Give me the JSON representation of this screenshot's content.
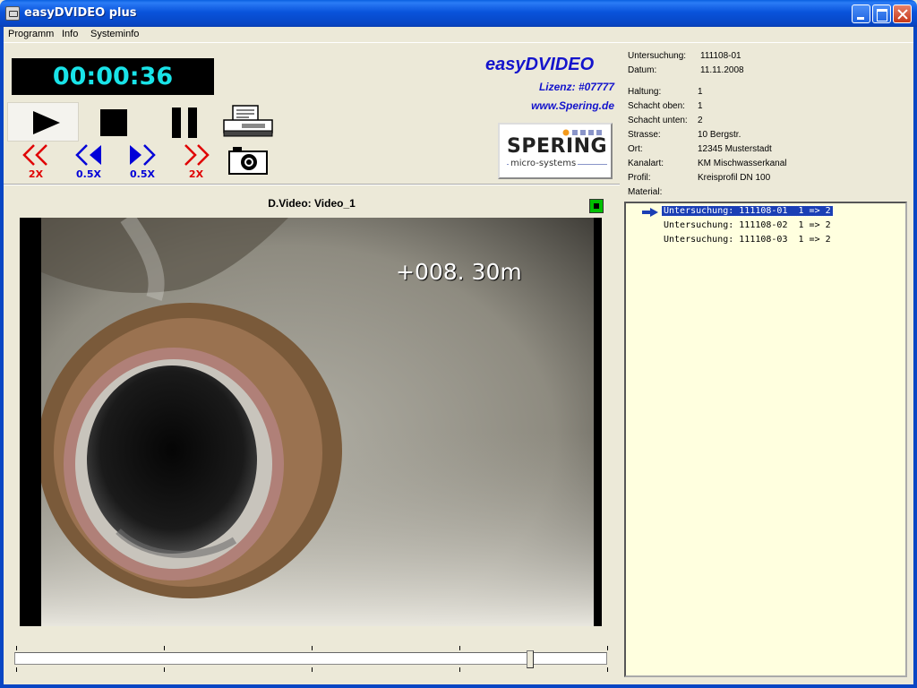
{
  "window": {
    "title": "easyDVIDEO plus"
  },
  "menu": {
    "items": [
      "Programm",
      "Info",
      "Systeminfo"
    ]
  },
  "player": {
    "time": "00:00:36",
    "speed_buttons": [
      {
        "label": "2X",
        "color": "#E00000"
      },
      {
        "label": "0.5X",
        "color": "#0000D8"
      },
      {
        "label": "0.5X",
        "color": "#0000D8"
      },
      {
        "label": "2X",
        "color": "#E00000"
      }
    ]
  },
  "brand": {
    "title": "easyDVIDEO",
    "license": "Lizenz: #07777",
    "url": "www.Spering.de",
    "logo_word": "SPERING",
    "logo_sub": "micro-systems"
  },
  "video": {
    "title": "D.Video: Video_1",
    "overlay_distance": "+008. 30m",
    "position_fraction": 0.875
  },
  "info": {
    "rows": [
      {
        "label": "Untersuchung:",
        "value": "111108-01"
      },
      {
        "label": "Datum:",
        "value": "11.11.2008"
      },
      {
        "label": "Haltung:",
        "value": "1"
      },
      {
        "label": "Schacht oben:",
        "value": "1"
      },
      {
        "label": "Schacht unten:",
        "value": "2"
      },
      {
        "label": "Strasse:",
        "value": "10 Bergstr."
      },
      {
        "label": "Ort:",
        "value": "12345 Musterstadt"
      },
      {
        "label": "Kanalart:",
        "value": "KM Mischwasserkanal"
      },
      {
        "label": "Profil:",
        "value": "Kreisprofil DN 100"
      },
      {
        "label": "Material:",
        "value": ""
      }
    ]
  },
  "list": {
    "items": [
      {
        "label": "Untersuchung: 111108-01  1 => 2",
        "selected": true
      },
      {
        "label": "Untersuchung: 111108-02  1 => 2",
        "selected": false
      },
      {
        "label": "Untersuchung: 111108-03  1 => 2",
        "selected": false
      }
    ]
  }
}
